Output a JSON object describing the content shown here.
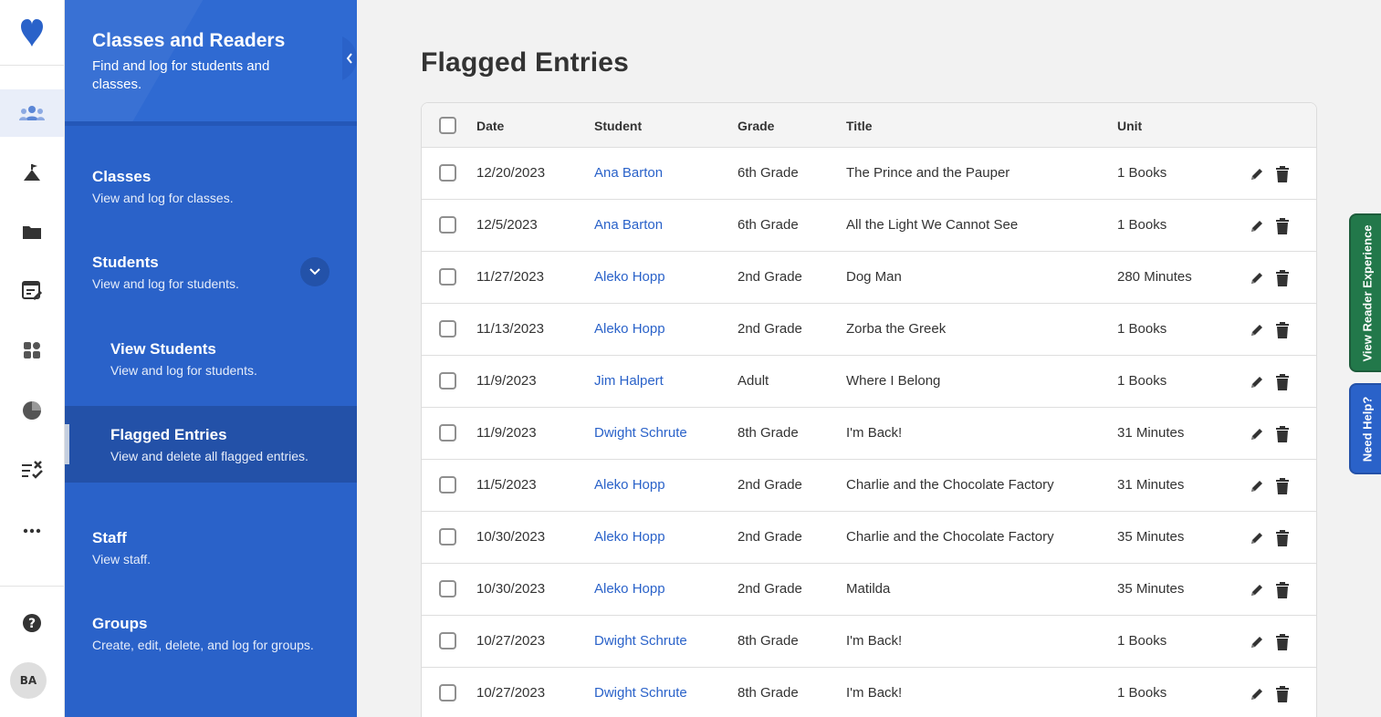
{
  "sidebar_panel": {
    "title": "Classes and Readers",
    "subtitle": "Find and log for students and classes.",
    "items": [
      {
        "label": "Classes",
        "desc": "View and log for classes."
      },
      {
        "label": "Students",
        "desc": "View and log for students."
      },
      {
        "label": "View Students",
        "desc": "View and log for students."
      },
      {
        "label": "Flagged Entries",
        "desc": "View and delete all flagged entries."
      },
      {
        "label": "Staff",
        "desc": "View staff."
      },
      {
        "label": "Groups",
        "desc": "Create, edit, delete, and log for groups."
      }
    ]
  },
  "rail": {
    "icons": [
      "heart-logo",
      "readers-icon",
      "challenges-icon",
      "folder-icon",
      "log-icon",
      "dashboard-icon",
      "reports-icon",
      "tasks-icon",
      "more-icon",
      "help-icon"
    ],
    "avatar": "BA"
  },
  "main": {
    "page_title": "Flagged Entries",
    "columns": [
      "Date",
      "Student",
      "Grade",
      "Title",
      "Unit"
    ],
    "rows": [
      {
        "date": "12/20/2023",
        "student": "Ana Barton",
        "grade": "6th Grade",
        "title": "The Prince and the Pauper",
        "unit": "1 Books"
      },
      {
        "date": "12/5/2023",
        "student": "Ana Barton",
        "grade": "6th Grade",
        "title": "All the Light We Cannot See",
        "unit": "1 Books"
      },
      {
        "date": "11/27/2023",
        "student": "Aleko Hopp",
        "grade": "2nd Grade",
        "title": "Dog Man",
        "unit": "280 Minutes"
      },
      {
        "date": "11/13/2023",
        "student": "Aleko Hopp",
        "grade": "2nd Grade",
        "title": "Zorba the Greek",
        "unit": "1 Books"
      },
      {
        "date": "11/9/2023",
        "student": "Jim Halpert",
        "grade": "Adult",
        "title": "Where I Belong",
        "unit": "1 Books"
      },
      {
        "date": "11/9/2023",
        "student": "Dwight Schrute",
        "grade": "8th Grade",
        "title": "I'm Back!",
        "unit": "31 Minutes"
      },
      {
        "date": "11/5/2023",
        "student": "Aleko Hopp",
        "grade": "2nd Grade",
        "title": "Charlie and the Chocolate Factory",
        "unit": "31 Minutes"
      },
      {
        "date": "10/30/2023",
        "student": "Aleko Hopp",
        "grade": "2nd Grade",
        "title": "Charlie and the Chocolate Factory",
        "unit": "35 Minutes"
      },
      {
        "date": "10/30/2023",
        "student": "Aleko Hopp",
        "grade": "2nd Grade",
        "title": "Matilda",
        "unit": "35 Minutes"
      },
      {
        "date": "10/27/2023",
        "student": "Dwight Schrute",
        "grade": "8th Grade",
        "title": "I'm Back!",
        "unit": "1 Books"
      },
      {
        "date": "10/27/2023",
        "student": "Dwight Schrute",
        "grade": "8th Grade",
        "title": "I'm Back!",
        "unit": "1 Books"
      }
    ]
  },
  "side_tabs": {
    "view_reader": "View Reader Experience",
    "help": "Need Help?"
  },
  "colors": {
    "brand_blue": "#2a62c9",
    "green_tab": "#22784a"
  }
}
